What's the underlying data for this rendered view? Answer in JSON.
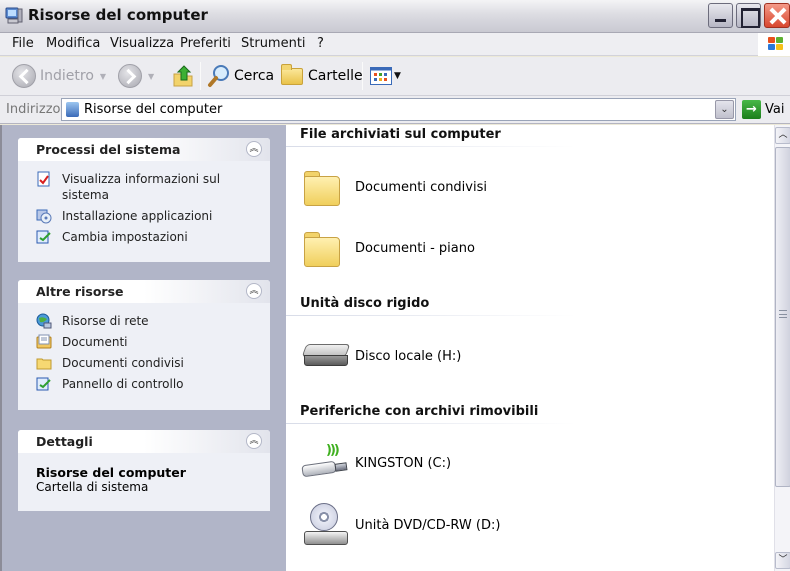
{
  "window": {
    "title": "Risorse del computer",
    "icon": "my-computer-icon",
    "controls": [
      "minimize",
      "maximize",
      "close"
    ]
  },
  "menu": {
    "items": [
      "File",
      "Modifica",
      "Visualizza",
      "Preferiti",
      "Strumenti",
      "?"
    ]
  },
  "toolbar": {
    "back_label": "Indietro",
    "search_label": "Cerca",
    "folders_label": "Cartelle",
    "icons": {
      "back": "back-arrow-icon",
      "forward": "forward-arrow-icon",
      "up": "up-folder-icon",
      "search": "magnifier-icon",
      "folders": "folders-icon",
      "views": "views-icon"
    }
  },
  "address": {
    "label": "Indirizzo",
    "value": "Risorse del computer",
    "go_label": "Vai"
  },
  "taskpane": {
    "panels": [
      {
        "title": "Processi del sistema",
        "tasks": [
          {
            "label": "Visualizza informazioni sul sistema",
            "icon": "system-info-icon"
          },
          {
            "label": "Installazione applicazioni",
            "icon": "add-remove-programs-icon"
          },
          {
            "label": "Cambia impostazioni",
            "icon": "control-panel-icon"
          }
        ]
      },
      {
        "title": "Altre risorse",
        "tasks": [
          {
            "label": "Risorse di rete",
            "icon": "network-icon"
          },
          {
            "label": "Documenti",
            "icon": "my-documents-icon"
          },
          {
            "label": "Documenti condivisi",
            "icon": "folder-icon"
          },
          {
            "label": "Pannello di controllo",
            "icon": "control-panel-icon"
          }
        ]
      },
      {
        "title": "Dettagli",
        "detail_name": "Risorse del computer",
        "detail_type": "Cartella di sistema"
      }
    ]
  },
  "content": {
    "groups": [
      {
        "title": "File archiviati sul computer",
        "items": [
          {
            "label": "Documenti condivisi",
            "icon": "folder-icon"
          },
          {
            "label": "Documenti - piano",
            "icon": "folder-icon"
          }
        ]
      },
      {
        "title": "Unità disco rigido",
        "items": [
          {
            "label": "Disco locale (H:)",
            "icon": "hard-disk-icon"
          }
        ]
      },
      {
        "title": "Periferiche con archivi rimovibili",
        "items": [
          {
            "label": "KINGSTON (C:)",
            "icon": "usb-drive-icon"
          },
          {
            "label": "Unità DVD/CD-RW (D:)",
            "icon": "dvd-drive-icon"
          }
        ]
      }
    ]
  },
  "colors": {
    "taskpane_bg": "#b1b5c8",
    "panel_bg": "#eef0f6",
    "go_green": "#2a9a2a",
    "close_red": "#d8462e"
  }
}
